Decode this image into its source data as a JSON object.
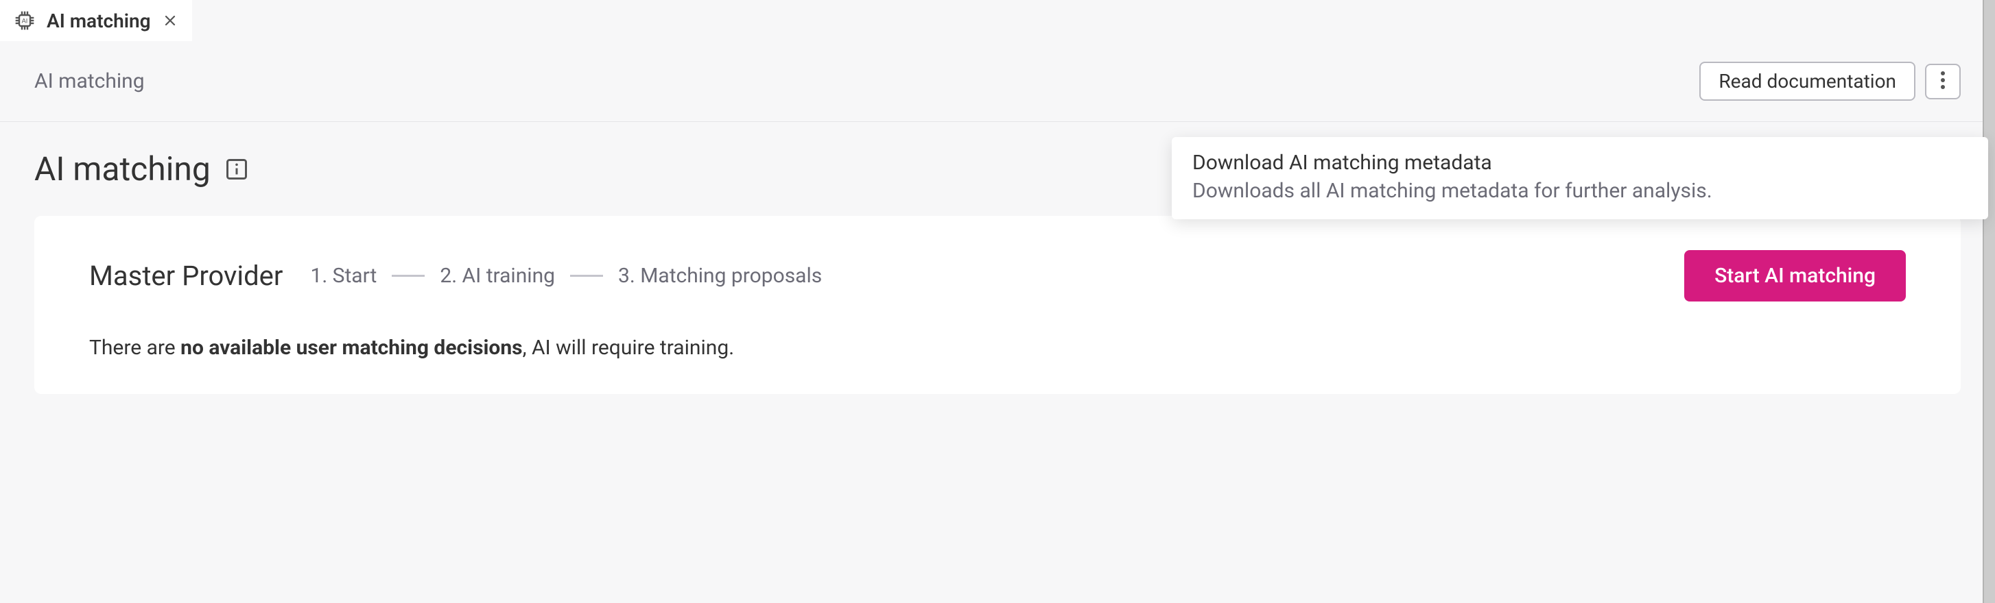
{
  "tab": {
    "label": "AI matching"
  },
  "header": {
    "breadcrumb": "AI matching",
    "read_docs_label": "Read documentation"
  },
  "dropdown": {
    "item_title": "Download AI matching metadata",
    "item_description": "Downloads all AI matching metadata for further analysis."
  },
  "page": {
    "title": "AI matching"
  },
  "card": {
    "provider": "Master Provider",
    "steps": [
      "1. Start",
      "2. AI training",
      "3. Matching proposals"
    ],
    "primary_button": "Start AI matching",
    "body_prefix": "There are ",
    "body_bold": "no available user matching decisions",
    "body_suffix": ", AI will require training."
  }
}
